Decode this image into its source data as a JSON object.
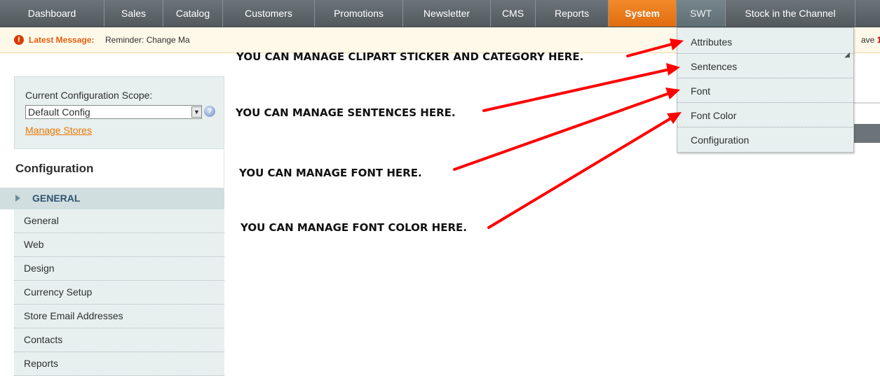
{
  "nav": {
    "items": [
      {
        "label": "Dashboard"
      },
      {
        "label": "Sales"
      },
      {
        "label": "Catalog"
      },
      {
        "label": "Customers"
      },
      {
        "label": "Promotions"
      },
      {
        "label": "Newsletter"
      },
      {
        "label": "CMS"
      },
      {
        "label": "Reports"
      },
      {
        "label": "System",
        "active": true
      },
      {
        "label": "SWT"
      },
      {
        "label": "Stock in the Channel"
      }
    ]
  },
  "message": {
    "label": "Latest Message:",
    "text": "Reminder: Change Ma",
    "right_text": "ave",
    "right_count": "1"
  },
  "scope": {
    "label": "Current Configuration Scope:",
    "selected": "Default Config",
    "manage_link": "Manage Stores"
  },
  "sidebar": {
    "title": "Configuration",
    "section": "GENERAL",
    "items": [
      {
        "label": "General"
      },
      {
        "label": "Web"
      },
      {
        "label": "Design"
      },
      {
        "label": "Currency Setup"
      },
      {
        "label": "Store Email Addresses"
      },
      {
        "label": "Contacts"
      },
      {
        "label": "Reports"
      }
    ]
  },
  "dropdown": {
    "items": [
      {
        "label": "Attributes"
      },
      {
        "label": "Sentences"
      },
      {
        "label": "Font"
      },
      {
        "label": "Font Color"
      },
      {
        "label": "Configuration"
      }
    ]
  },
  "captions": {
    "clipart": "YOU CAN MANAGE CLIPART STICKER AND CATEGORY HERE.",
    "sentences": "YOU CAN MANAGE SENTENCES HERE.",
    "font": "YOU CAN MANAGE FONT HERE.",
    "font_color": "YOU CAN MANAGE FONT COLOR HERE."
  },
  "colors": {
    "accent": "#eb7a1b",
    "arrow": "#ff0000",
    "nav_bg": "#5d6468",
    "sidebar_bg": "#e7efef"
  }
}
